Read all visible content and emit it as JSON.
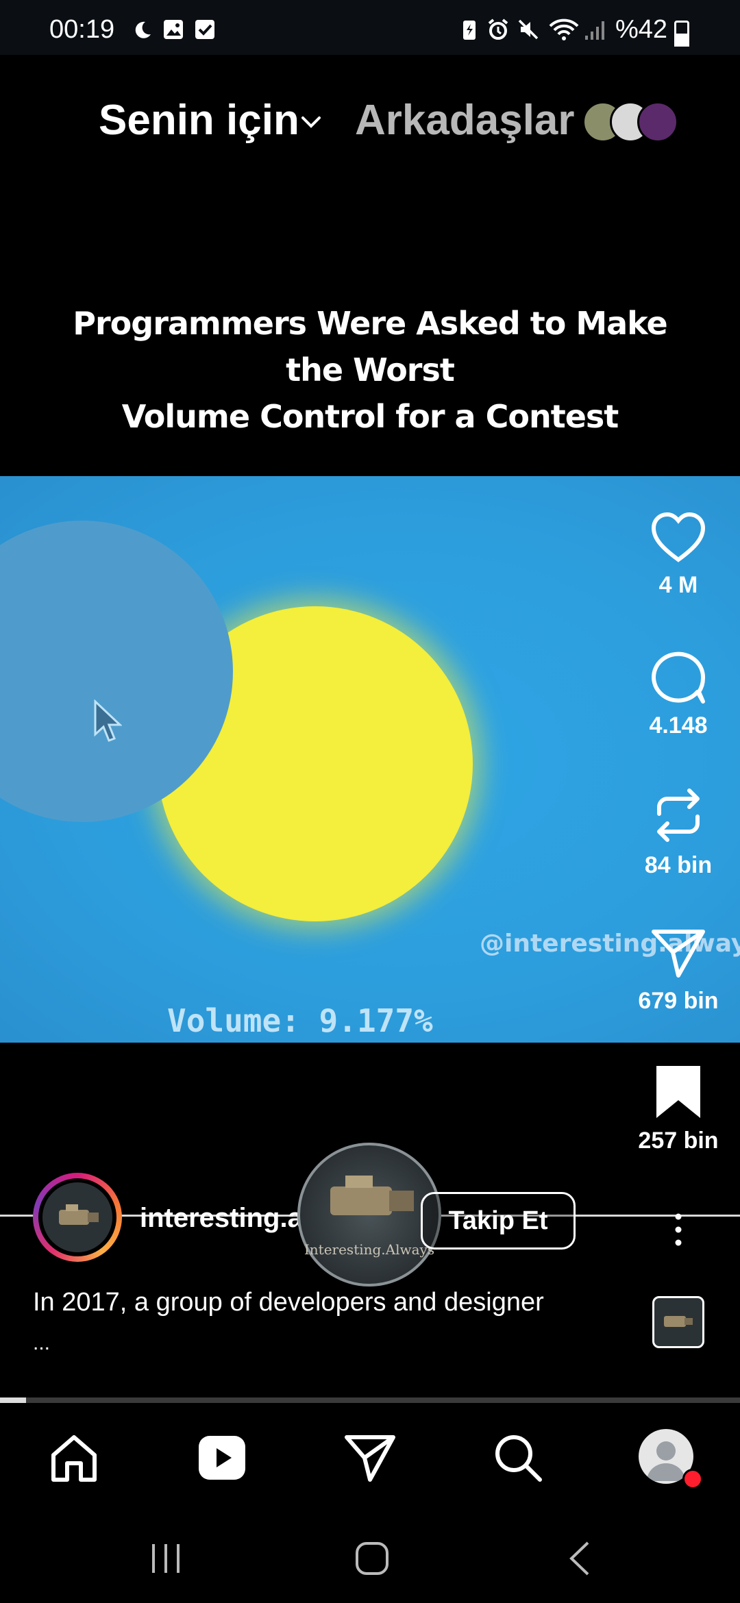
{
  "status_bar": {
    "time": "00:19",
    "battery": "%42",
    "icons": [
      "moon-icon",
      "gallery-icon",
      "checkbox-icon",
      "battery-saver-icon",
      "alarm-icon",
      "mute-icon",
      "wifi-icon",
      "signal-icon",
      "battery-icon"
    ]
  },
  "top_tabs": {
    "for_you": "Senin için",
    "friends": "Arkadaşlar"
  },
  "video": {
    "title_line1": "Programmers Were Asked to Make the Worst",
    "title_line2": "Volume Control for a Contest",
    "watermark": "@interesting.always",
    "volume_readout": "Volume: 9.177%"
  },
  "actions": {
    "likes": "4 M",
    "comments": "4.148",
    "reposts": "84 bin",
    "shares": "679 bin",
    "saves": "257 bin"
  },
  "author": {
    "name": "interesting.always",
    "follow_label": "Takip Et",
    "disc_label": "Interesting.Always"
  },
  "caption": {
    "text": "In 2017, a group of developers and designer",
    "more": "..."
  },
  "playback": {
    "progress": 0.035
  },
  "colors": {
    "background": "#000000",
    "video_sky": "#2d9ddc",
    "sun": "#f4ee3c",
    "notification_dot": "#ff1e2d"
  }
}
